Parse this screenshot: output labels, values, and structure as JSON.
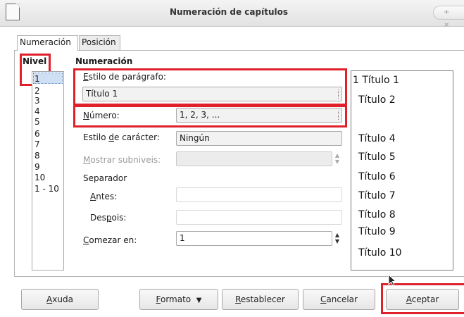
{
  "window": {
    "title": "Numeración de capítulos",
    "controls_glyph": "+ ×"
  },
  "tabs": [
    {
      "label": "Numeración"
    },
    {
      "label": "Posición"
    }
  ],
  "nivel": {
    "label": "Nivel",
    "items": [
      "1",
      "2",
      "3",
      "4",
      "5",
      "6",
      "7",
      "8",
      "9",
      "10",
      "1 - 10"
    ],
    "selected": "1"
  },
  "numeracion": {
    "heading": "Numeración",
    "estilo_paragrafo": {
      "label_pre": "",
      "label_u": "E",
      "label_post": "stilo de parágrafo:",
      "value": "Título 1"
    },
    "numero": {
      "label_pre": "",
      "label_u": "N",
      "label_post": "úmero:",
      "value": "1, 2, 3, ..."
    },
    "estilo_caracter": {
      "label_pre": "Estilo ",
      "label_u": "d",
      "label_post": "e carácter:",
      "value": "Ningún"
    },
    "mostrar_subniveis": {
      "label_pre": "",
      "label_u": "M",
      "label_post": "ostrar subniveis:",
      "value": ""
    },
    "separador": {
      "label": "Separador"
    },
    "antes": {
      "label_pre": "",
      "label_u": "A",
      "label_post": "ntes:",
      "value": ""
    },
    "despois": {
      "label_pre": "Des",
      "label_u": "p",
      "label_post": "ois:",
      "value": ""
    },
    "comezar_en": {
      "label_pre": "",
      "label_u": "C",
      "label_post": "omezar en:",
      "value": "1"
    }
  },
  "preview": {
    "lines": [
      "1 Título 1",
      "Título 2",
      "Título 4",
      "Título 5",
      "Título 6",
      "Título 7",
      "Título 8",
      "Título 9",
      "Título 10"
    ]
  },
  "buttons": {
    "axuda": {
      "u": "A",
      "rest": "xuda"
    },
    "formato": {
      "u": "F",
      "rest": "ormato",
      "arrow": "▼"
    },
    "restablecer": {
      "u": "R",
      "rest": "establecer"
    },
    "cancelar": {
      "u": "C",
      "rest": "ancelar"
    },
    "aceptar": {
      "u": "A",
      "rest": "ceptar"
    }
  }
}
